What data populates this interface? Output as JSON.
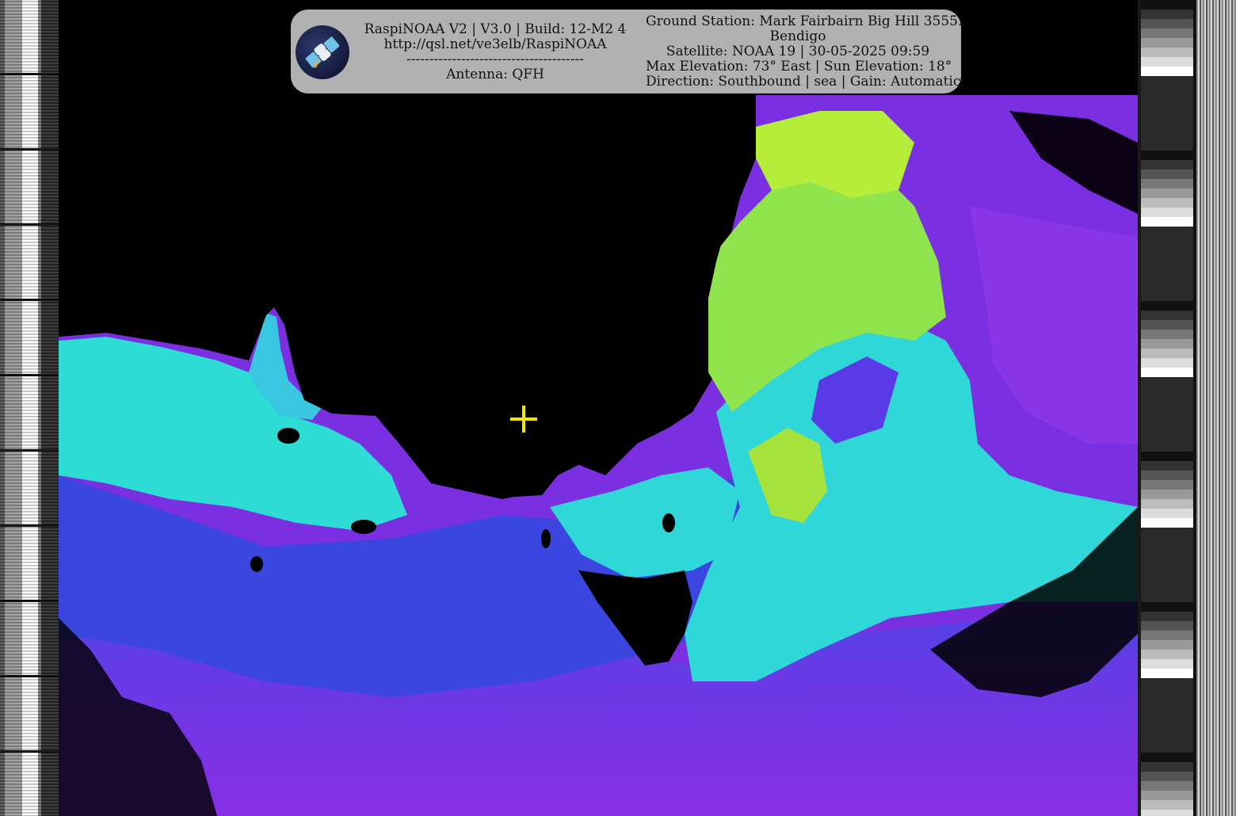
{
  "panel": {
    "left_lines": [
      "RaspiNOAA V2 | V3.0 | Build: 12-M2 4",
      "http://qsl.net/ve3elb/RaspiNOAA",
      "---------------------------------------",
      "Antenna: QFH"
    ],
    "right_lines": [
      "Ground Station: Mark Fairbairn Big Hill 3555.",
      "Bendigo",
      "Satellite: NOAA 19 | 30-05-2025 09:59",
      "Max Elevation: 73° East | Sun Elevation: 18°",
      "Direction: Southbound | sea | Gain: Automatic"
    ]
  },
  "logo": {
    "icon": "satellite-icon"
  },
  "marker": {
    "icon": "crosshair-icon",
    "color": "#f5e600"
  },
  "colors": {
    "land": "#000000",
    "sea_warm": "#9be84a",
    "sea_mid": "#2fe0d8",
    "sea_cool": "#3a4ee6",
    "sea_cold": "#8a2fe6",
    "panel_bg": "#bebebe"
  }
}
